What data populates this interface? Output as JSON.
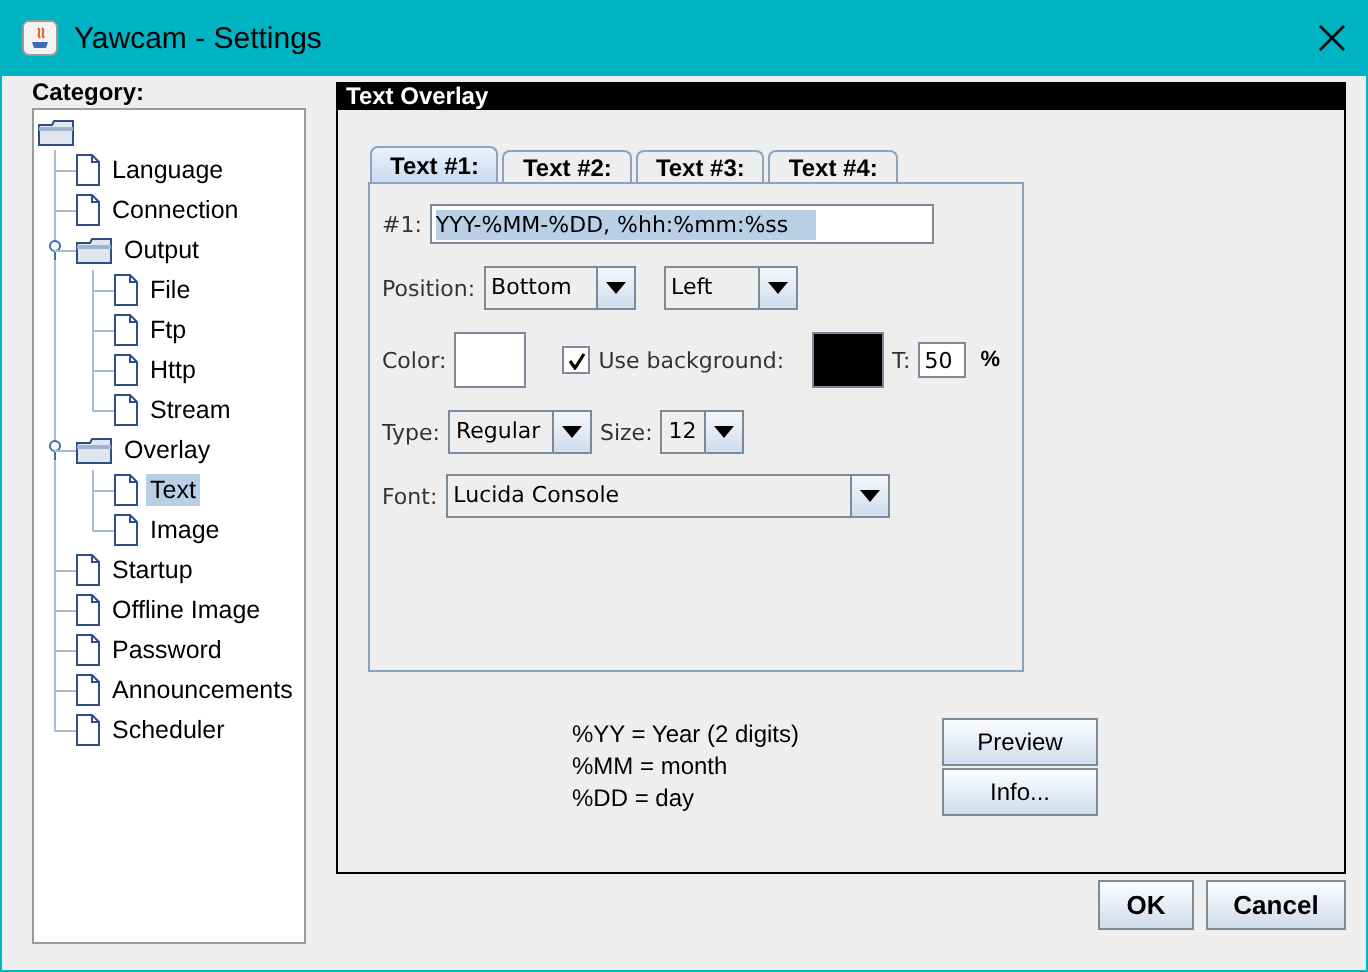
{
  "window": {
    "title": "Yawcam - Settings"
  },
  "category_label": "Category:",
  "tree": {
    "items": [
      {
        "label": "Language",
        "kind": "file",
        "selected": false
      },
      {
        "label": "Connection",
        "kind": "file",
        "selected": false
      },
      {
        "label": "Output",
        "kind": "folder",
        "selected": false,
        "expanded": true,
        "children": [
          {
            "label": "File",
            "kind": "file",
            "selected": false
          },
          {
            "label": "Ftp",
            "kind": "file",
            "selected": false
          },
          {
            "label": "Http",
            "kind": "file",
            "selected": false
          },
          {
            "label": "Stream",
            "kind": "file",
            "selected": false
          }
        ]
      },
      {
        "label": "Overlay",
        "kind": "folder",
        "selected": false,
        "expanded": true,
        "children": [
          {
            "label": "Text",
            "kind": "file",
            "selected": true
          },
          {
            "label": "Image",
            "kind": "file",
            "selected": false
          }
        ]
      },
      {
        "label": "Startup",
        "kind": "file",
        "selected": false
      },
      {
        "label": "Offline Image",
        "kind": "file",
        "selected": false
      },
      {
        "label": "Password",
        "kind": "file",
        "selected": false
      },
      {
        "label": "Announcements",
        "kind": "file",
        "selected": false
      },
      {
        "label": "Scheduler",
        "kind": "file",
        "selected": false
      }
    ]
  },
  "panel": {
    "title": "Text Overlay",
    "tabs": [
      {
        "label": "Text #1:",
        "selected": true
      },
      {
        "label": "Text #2:",
        "selected": false
      },
      {
        "label": "Text #3:",
        "selected": false
      },
      {
        "label": "Text #4:",
        "selected": false
      }
    ],
    "text_label": "#1:",
    "text_value": "YYY-%MM-%DD, %hh:%mm:%ss",
    "position_label": "Position:",
    "position_vertical": "Bottom",
    "position_horizontal": "Left",
    "color_label": "Color:",
    "use_background": {
      "label": "Use background:",
      "checked": true
    },
    "transparency_label": "T:",
    "transparency_value": "50",
    "transparency_unit": "%",
    "type_label": "Type:",
    "type_value": "Regular",
    "size_label": "Size:",
    "size_value": "12",
    "font_label": "Font:",
    "font_value": "Lucida Console",
    "legend": [
      "%YY = Year (2 digits)",
      "%MM = month",
      "%DD = day"
    ],
    "buttons": [
      "Preview",
      "Info..."
    ]
  },
  "buttons": [
    "OK",
    "Cancel"
  ]
}
